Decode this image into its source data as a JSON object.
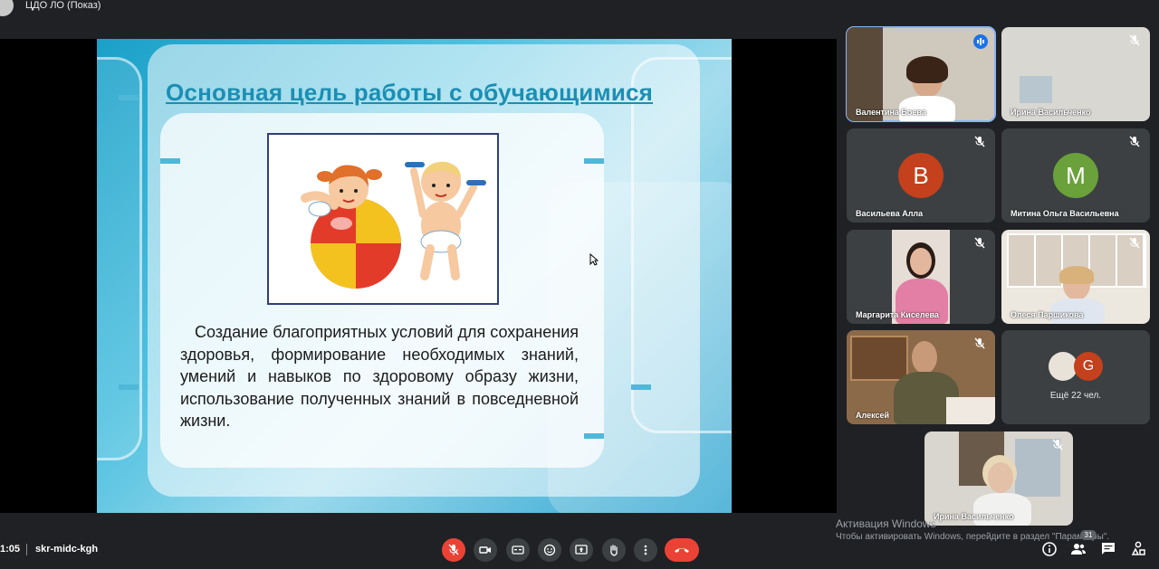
{
  "header": {
    "presenter_label": "ЦДО ЛО (Показ)"
  },
  "slide": {
    "title": "Основная цель работы с обучающимися",
    "body": "Создание благоприятных условий для сохранения здоровья, формирование необходимых знаний, умений и навыков по здоровому образу жизни, использование полученных знаний в повседневной жизни."
  },
  "participants": [
    {
      "name": "Валентина Боева",
      "state": "speaking"
    },
    {
      "name": "Ирина Васильченко",
      "state": "muted"
    },
    {
      "name": "Васильева Алла",
      "initial": "В",
      "avatar_color": "#c5401c",
      "state": "muted"
    },
    {
      "name": "Митина Ольга Васильевна",
      "initial": "М",
      "avatar_color": "#6aa13a",
      "state": "muted"
    },
    {
      "name": "Маргарита Киселева",
      "state": "muted"
    },
    {
      "name": "Олеся Паршикова",
      "state": "muted"
    },
    {
      "name": "Алексей",
      "state": "muted"
    },
    {
      "name": "Ирина Васильченко",
      "state": "muted"
    }
  ],
  "more_tile": {
    "label": "Ещё 22 чел.",
    "initial": "G",
    "avatar_color": "#c5401c"
  },
  "footer": {
    "clock": "1:05",
    "meeting_code": "skr-midc-kgh",
    "people_count": "31"
  },
  "watermark": {
    "title": "Активация Windows",
    "subtitle": "Чтобы активировать Windows, перейдите в раздел \"Параметры\"."
  },
  "colors": {
    "accent": "#8ab4f8",
    "danger": "#ea4335",
    "tile": "#3c4043",
    "background": "#202124"
  }
}
